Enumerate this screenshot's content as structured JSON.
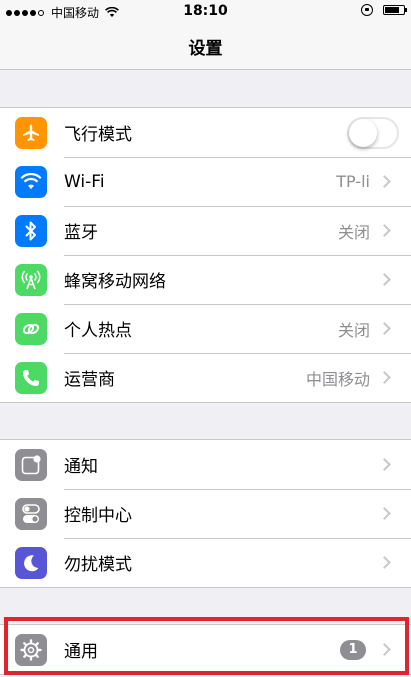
{
  "status_bar": {
    "carrier": "中国移动",
    "time": "18:10",
    "signal_strength": 4,
    "signal_max": 5,
    "battery_level": 0.8
  },
  "nav": {
    "title": "设置"
  },
  "groups": [
    {
      "rows": [
        {
          "label": "飞行模式",
          "icon": "airplane-icon",
          "icon_color": "#ff9500",
          "control": "toggle",
          "toggle_on": false
        },
        {
          "label": "Wi-Fi",
          "icon": "wifi-icon",
          "icon_color": "#007aff",
          "value": "TP-li"
        },
        {
          "label": "蓝牙",
          "icon": "bluetooth-icon",
          "icon_color": "#007aff",
          "value": "关闭"
        },
        {
          "label": "蜂窝移动网络",
          "icon": "cellular-antenna-icon",
          "icon_color": "#4cd964"
        },
        {
          "label": "个人热点",
          "icon": "hotspot-icon",
          "icon_color": "#4cd964",
          "value": "关闭"
        },
        {
          "label": "运营商",
          "icon": "phone-icon",
          "icon_color": "#4cd964",
          "value": "中国移动"
        }
      ]
    },
    {
      "rows": [
        {
          "label": "通知",
          "icon": "notifications-icon",
          "icon_color": "#8e8e93"
        },
        {
          "label": "控制中心",
          "icon": "control-center-icon",
          "icon_color": "#8e8e93"
        },
        {
          "label": "勿扰模式",
          "icon": "moon-icon",
          "icon_color": "#5856d6"
        }
      ]
    },
    {
      "rows": [
        {
          "label": "通用",
          "icon": "gear-icon",
          "icon_color": "#8e8e93",
          "badge": "1"
        }
      ]
    }
  ],
  "highlight_color": "#e0252f"
}
